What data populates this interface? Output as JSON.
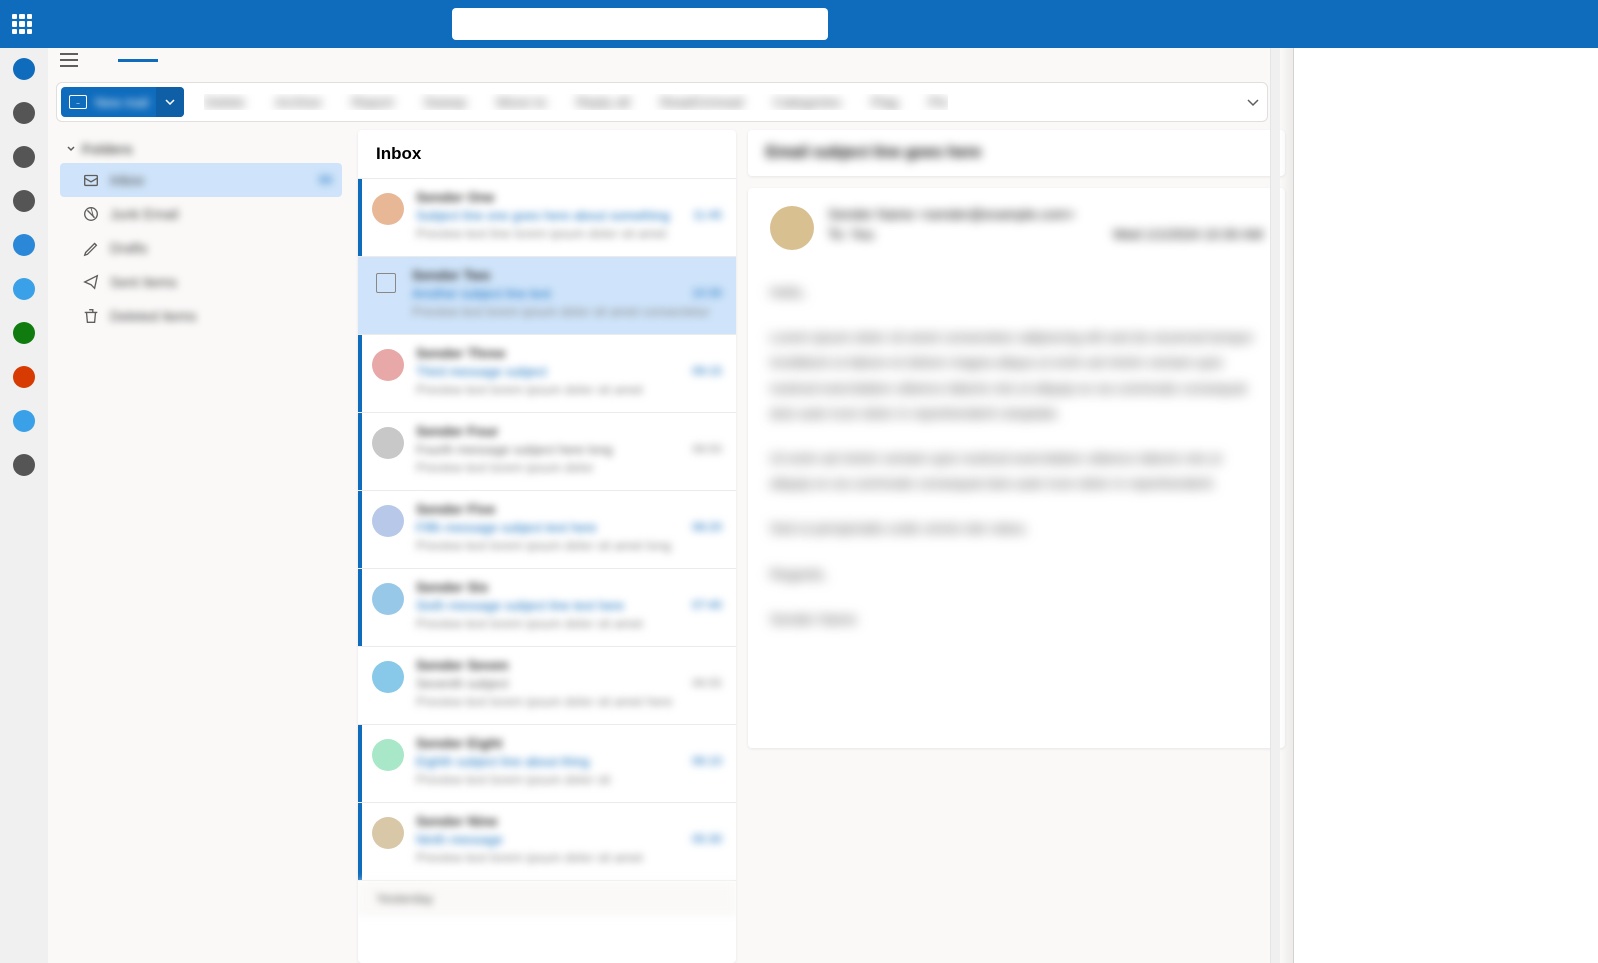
{
  "search": {
    "placeholder": ""
  },
  "rail": [
    {
      "color": "#0f6cbd"
    },
    {
      "color": "#555555"
    },
    {
      "color": "#555555"
    },
    {
      "color": "#555555"
    },
    {
      "color": "#2b88d8"
    },
    {
      "color": "#3aa0e8"
    },
    {
      "color": "#107c10"
    },
    {
      "color": "#d83b01"
    },
    {
      "color": "#3aa0e8"
    },
    {
      "color": "#555555"
    }
  ],
  "newMailButton": {
    "label": "New mail"
  },
  "ribbonItems": [
    "Delete",
    "Archive",
    "Report",
    "Sweep",
    "Move to",
    "Reply all",
    "Read/Unread",
    "Categories",
    "Flag",
    "Pin"
  ],
  "folderHeader": "Folders",
  "folders": [
    {
      "label": "Inbox",
      "count": "99",
      "active": true
    },
    {
      "label": "Junk Email",
      "count": ""
    },
    {
      "label": "Drafts",
      "count": ""
    },
    {
      "label": "Sent Items",
      "count": ""
    },
    {
      "label": "Deleted Items",
      "count": ""
    }
  ],
  "listHeader": "Inbox",
  "messages": [
    {
      "sender": "Sender One",
      "subject": "Subject line one goes here about something",
      "preview": "Preview text line lorem ipsum dolor sit amet",
      "time": "11:45",
      "avatarColor": "#e8b896",
      "unread": true,
      "selected": false
    },
    {
      "sender": "Sender Two",
      "subject": "Another subject line text",
      "preview": "Preview text lorem ipsum dolor sit amet consectetur",
      "time": "10:30",
      "avatarColor": "",
      "unread": false,
      "selected": true
    },
    {
      "sender": "Sender Three",
      "subject": "Third message subject",
      "preview": "Preview text lorem ipsum dolor sit amet",
      "time": "09:15",
      "avatarColor": "#e8a8a8",
      "unread": true,
      "selected": false
    },
    {
      "sender": "Sender Four",
      "subject": "Fourth message subject here long",
      "preview": "Preview text lorem ipsum dolor",
      "time": "08:50",
      "avatarColor": "#c8c8c8",
      "unread": true,
      "selected": false,
      "read": true
    },
    {
      "sender": "Sender Five",
      "subject": "Fifth message subject text here",
      "preview": "Preview text lorem ipsum dolor sit amet long",
      "time": "08:20",
      "avatarColor": "#b8c8e8",
      "unread": true,
      "selected": false
    },
    {
      "sender": "Sender Six",
      "subject": "Sixth message subject line text here",
      "preview": "Preview text lorem ipsum dolor sit amet",
      "time": "07:40",
      "avatarColor": "#98c8e8",
      "unread": true,
      "selected": false
    },
    {
      "sender": "Sender Seven",
      "subject": "Seventh subject",
      "preview": "Preview text lorem ipsum dolor sit amet here",
      "time": "06:55",
      "avatarColor": "#88c8e8",
      "unread": false,
      "selected": false,
      "read": true
    },
    {
      "sender": "Sender Eight",
      "subject": "Eighth subject line about thing",
      "preview": "Preview text lorem ipsum dolor sit",
      "time": "06:10",
      "avatarColor": "#a8e8c8",
      "unread": true,
      "selected": false
    },
    {
      "sender": "Sender Nine",
      "subject": "Ninth message",
      "preview": "Preview text lorem ipsum dolor sit amet",
      "time": "05:30",
      "avatarColor": "#d8c8a8",
      "unread": true,
      "selected": false
    }
  ],
  "sectionLabel": "Yesterday",
  "reading": {
    "subject": "Email subject line goes here",
    "avatarColor": "#d8c090",
    "fromName": "Sender Name <sender@example.com>",
    "toLine": "To: You",
    "dateLine": "Wed 1/1/2024 10:30 AM",
    "greeting": "Hello,",
    "para1": "Lorem ipsum dolor sit amet consectetur adipiscing elit sed do eiusmod tempor incididunt ut labore et dolore magna aliqua ut enim ad minim veniam quis nostrud exercitation ullamco laboris nisi ut aliquip ex ea commodo consequat duis aute irure dolor in reprehenderit voluptate.",
    "para2": "Ut enim ad minim veniam quis nostrud exercitation ullamco laboris nisi ut aliquip ex ea commodo consequat duis aute irure dolor in reprehenderit.",
    "para3": "Sed ut perspiciatis unde omnis iste natus.",
    "signoff": "Regards,",
    "signature": "Sender Name"
  }
}
